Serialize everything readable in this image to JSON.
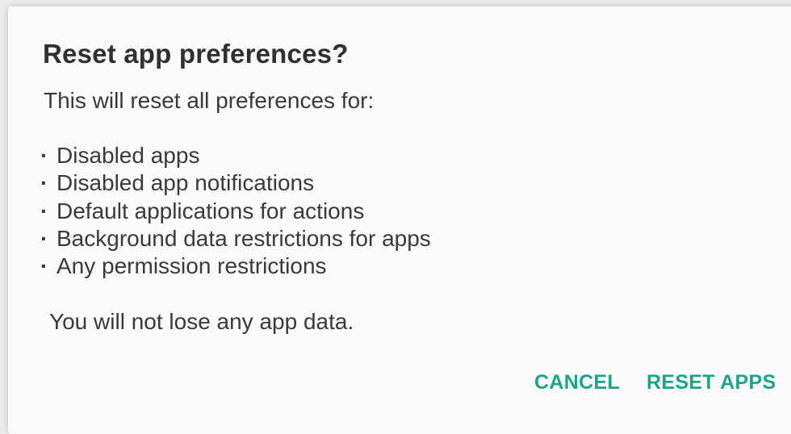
{
  "dialog": {
    "title": "Reset app preferences?",
    "intro": "This will reset all preferences for:",
    "bullet_glyph": "·",
    "items": [
      "Disabled apps",
      "Disabled app notifications",
      "Default applications for actions",
      "Background data restrictions for apps",
      "Any permission restrictions"
    ],
    "note": "You will not lose any app data.",
    "buttons": {
      "cancel": "CANCEL",
      "reset": "RESET APPS"
    }
  },
  "colors": {
    "accent": "#1ba58a",
    "text": "#3a3a3a",
    "title": "#303030",
    "dialog_background": "#fafafa"
  }
}
